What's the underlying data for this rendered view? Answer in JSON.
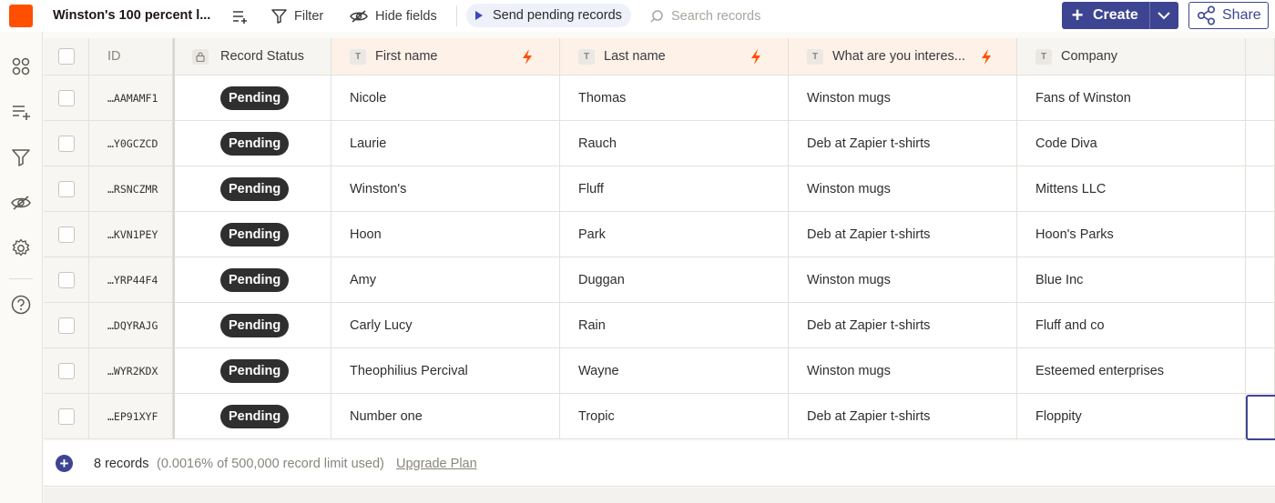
{
  "toolbar": {
    "title": "Winston's 100 percent l...",
    "filter_label": "Filter",
    "hide_fields_label": "Hide fields",
    "send_pending_label": "Send pending records",
    "search_placeholder": "Search records",
    "create_label": "Create",
    "share_label": "Share"
  },
  "colors": {
    "brand": "#ff4f00",
    "primary": "#3d4592",
    "pill": "#2f2f2f",
    "bolt": "#ff4f00"
  },
  "sidebar": {
    "icons": [
      "apps-icon",
      "add-field-icon",
      "filter-icon",
      "hide-icon",
      "settings-icon",
      "help-icon"
    ]
  },
  "table": {
    "columns": {
      "id": "ID",
      "status": "Record Status",
      "first": "First name",
      "last": "Last name",
      "interest": "What are you interes...",
      "company": "Company",
      "type_marker": "T"
    },
    "rows": [
      {
        "id": "…AAMAMF1",
        "status": "Pending",
        "first": "Nicole",
        "last": "Thomas",
        "interest": "Winston mugs",
        "company": "Fans of Winston"
      },
      {
        "id": "…Y0GCZCD",
        "status": "Pending",
        "first": "Laurie",
        "last": "Rauch",
        "interest": "Deb at Zapier t-shirts",
        "company": "Code Diva"
      },
      {
        "id": "…RSNCZMR",
        "status": "Pending",
        "first": "Winston's",
        "last": "Fluff",
        "interest": "Winston mugs",
        "company": "Mittens LLC"
      },
      {
        "id": "…KVN1PEY",
        "status": "Pending",
        "first": "Hoon",
        "last": "Park",
        "interest": "Deb at Zapier t-shirts",
        "company": "Hoon's Parks"
      },
      {
        "id": "…YRP44F4",
        "status": "Pending",
        "first": "Amy",
        "last": "Duggan",
        "interest": "Winston mugs",
        "company": "Blue Inc"
      },
      {
        "id": "…DQYRAJG",
        "status": "Pending",
        "first": "Carly Lucy",
        "last": "Rain",
        "interest": "Deb at Zapier t-shirts",
        "company": "Fluff and co"
      },
      {
        "id": "…WYR2KDX",
        "status": "Pending",
        "first": "Theophilius Percival",
        "last": "Wayne",
        "interest": "Winston mugs",
        "company": "Esteemed enterprises"
      },
      {
        "id": "…EP91XYF",
        "status": "Pending",
        "first": "Number one",
        "last": "Tropic",
        "interest": "Deb at Zapier t-shirts",
        "company": "Floppity"
      }
    ]
  },
  "footer": {
    "record_count": "8 records",
    "limit_text": "(0.0016% of 500,000 record limit used)",
    "upgrade_label": "Upgrade Plan"
  }
}
